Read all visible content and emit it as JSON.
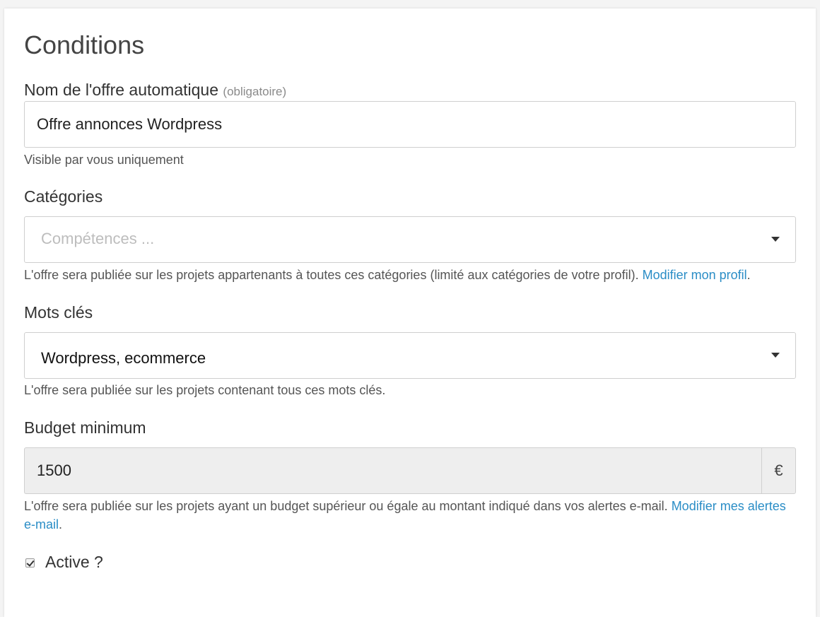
{
  "section": {
    "title": "Conditions"
  },
  "name_field": {
    "label": "Nom de l'offre automatique",
    "required_hint": "(obligatoire)",
    "value": "Offre annonces Wordpress",
    "help": "Visible par vous uniquement"
  },
  "categories_field": {
    "label": "Catégories",
    "placeholder": "Compétences ...",
    "help": "L'offre sera publiée sur les projets appartenants à toutes ces catégories (limité aux catégories de votre profil).",
    "help_link": "Modifier mon profil",
    "help_suffix": ".",
    "caret_icon": "caret-down-icon"
  },
  "keywords_field": {
    "label": "Mots clés",
    "value": "Wordpress, ecommerce",
    "help": "L'offre sera publiée sur les projets contenant tous ces mots clés.",
    "caret_icon": "caret-down-icon"
  },
  "budget_field": {
    "label": "Budget minimum",
    "value": "1500",
    "currency": "€",
    "help": "L'offre sera publiée sur les projets ayant un budget supérieur ou égale au montant indiqué dans vos alertes e-mail.",
    "help_link": "Modifier mes alertes e-mail",
    "help_suffix": "."
  },
  "active_checkbox": {
    "label": "Active ?",
    "checked": true
  },
  "colors": {
    "link": "#2a8dc6",
    "disabled_background": "#eeeeee",
    "border": "#cfcfcf"
  }
}
